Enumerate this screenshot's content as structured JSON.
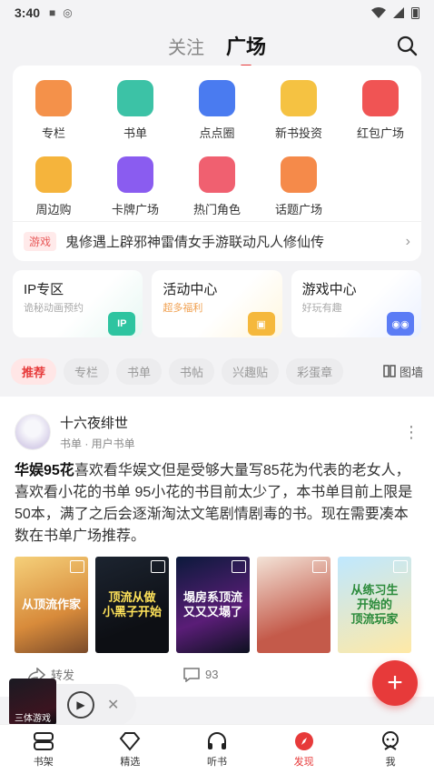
{
  "status": {
    "time": "3:40"
  },
  "nav": {
    "tabs": [
      {
        "label": "关注"
      },
      {
        "label": "广场"
      }
    ]
  },
  "grid": [
    {
      "label": "专栏",
      "icon": "column-icon",
      "color": "#f4914a"
    },
    {
      "label": "书单",
      "icon": "booklist-icon",
      "color": "#3cc2a6"
    },
    {
      "label": "点点圈",
      "icon": "circle-icon",
      "color": "#4a7bf0"
    },
    {
      "label": "新书投资",
      "icon": "invest-icon",
      "color": "#f5c242"
    },
    {
      "label": "红包广场",
      "icon": "redpacket-icon",
      "color": "#f05454"
    },
    {
      "label": "周边购",
      "icon": "fox-icon",
      "color": "#f5b43c"
    },
    {
      "label": "卡牌广场",
      "icon": "card-icon",
      "color": "#8a5cf0"
    },
    {
      "label": "热门角色",
      "icon": "role-icon",
      "color": "#f06070"
    },
    {
      "label": "话题广场",
      "icon": "topic-icon",
      "color": "#f58a4a"
    }
  ],
  "notice": {
    "tag": "游戏",
    "text": "鬼修遇上辟邪神雷倩女手游联动凡人修仙传"
  },
  "zones": [
    {
      "title": "IP专区",
      "sub": "诡秘动画预约",
      "badge": "IP",
      "color": "#2ec4a0"
    },
    {
      "title": "活动中心",
      "sub": "超多福利",
      "badge": "",
      "color": "#f5b83c"
    },
    {
      "title": "游戏中心",
      "sub": "好玩有趣",
      "badge": "",
      "color": "#5b7cf5"
    }
  ],
  "chips": [
    "推荐",
    "专栏",
    "书单",
    "书帖",
    "兴趣贴",
    "彩蛋章"
  ],
  "chip_layout": "图墙",
  "post": {
    "author": "十六夜绯世",
    "meta": "书单 · 用户书单",
    "title_bold": "华娱95花",
    "body": "喜欢看华娱文但是受够大量写85花为代表的老女人，喜欢看小花的书单 95小花的书目前太少了，本书单目前上限是50本，满了之后会逐渐淘汰文笔剧情剧毒的书。现在需要凑本数在书单广场推荐。",
    "covers": [
      "从顶流作家",
      "顶流从做\n小黑子开始",
      "塌房系顶流\n又又又塌了",
      "",
      "从练习生\n开始的\n顶流玩家"
    ],
    "share_label": "转发",
    "comment_count": "93"
  },
  "player": {
    "cover_text": "三体游戏"
  },
  "tabbar": [
    {
      "label": "书架"
    },
    {
      "label": "精选"
    },
    {
      "label": "听书"
    },
    {
      "label": "发现"
    },
    {
      "label": "我"
    }
  ]
}
